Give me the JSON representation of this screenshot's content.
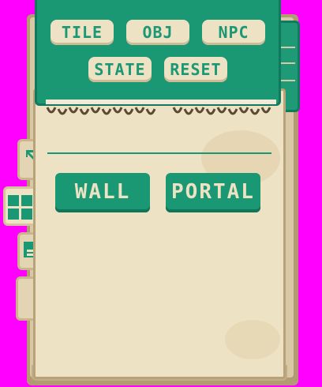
{
  "header": {
    "buttons_row1": [
      {
        "label": "TILE"
      },
      {
        "label": "OBJ"
      },
      {
        "label": "NPC"
      }
    ],
    "buttons_row2": [
      {
        "label": "STATE"
      },
      {
        "label": "RESET"
      }
    ]
  },
  "side_tabs": [
    {
      "icon": "arrow-cursor-icon",
      "active": false
    },
    {
      "icon": "grid-icon",
      "active": true
    },
    {
      "icon": "document-icon",
      "active": false
    },
    {
      "icon": "blank-tab",
      "active": false
    }
  ],
  "main": {
    "buttons": [
      {
        "label": "WALL"
      },
      {
        "label": "PORTAL"
      }
    ]
  },
  "colors": {
    "accent": "#1a9874",
    "paper": "#eee2c4",
    "paper_dark": "#b8a27a",
    "background": "#ff00ff"
  }
}
